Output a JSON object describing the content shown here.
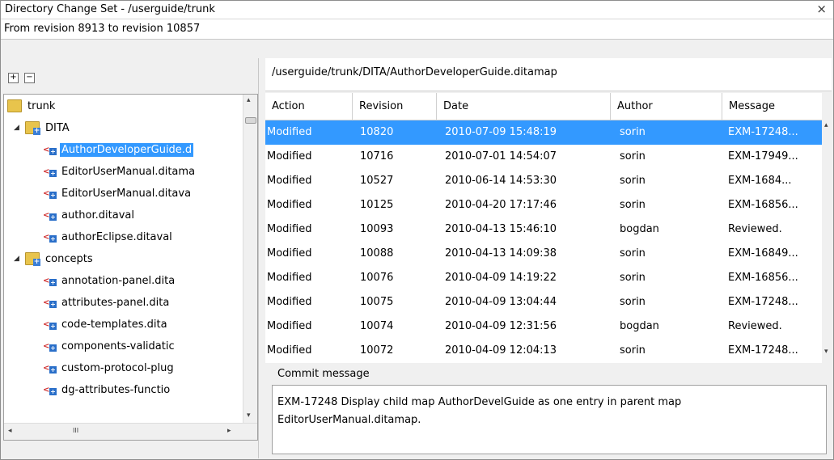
{
  "window": {
    "title": "Directory Change Set - /userguide/trunk",
    "close_glyph": "×",
    "revision_range": "From revision 8913 to revision 10857"
  },
  "toolbar": {
    "expand_icon": "expand-all-icon",
    "collapse_icon": "collapse-all-icon",
    "expand_glyph": "+",
    "collapse_glyph": "−"
  },
  "tree": {
    "nodes": [
      {
        "label": "trunk",
        "icon": "folder-icon"
      },
      {
        "label": "DITA",
        "icon": "folder-modified-icon"
      },
      {
        "label": "AuthorDeveloperGuide.d",
        "icon": "ditamap-icon"
      },
      {
        "label": "EditorUserManual.ditama",
        "icon": "ditamap-icon"
      },
      {
        "label": "EditorUserManual.ditava",
        "icon": "ditaval-icon"
      },
      {
        "label": "author.ditaval",
        "icon": "ditaval-icon"
      },
      {
        "label": "authorEclipse.ditaval",
        "icon": "ditaval-icon"
      },
      {
        "label": "concepts",
        "icon": "folder-modified-icon"
      },
      {
        "label": "annotation-panel.dita",
        "icon": "dita-icon"
      },
      {
        "label": "attributes-panel.dita",
        "icon": "dita-icon"
      },
      {
        "label": "code-templates.dita",
        "icon": "dita-icon"
      },
      {
        "label": "components-validatic",
        "icon": "dita-icon"
      },
      {
        "label": "custom-protocol-plug",
        "icon": "dita-icon"
      },
      {
        "label": "dg-attributes-functio",
        "icon": "dita-icon"
      }
    ],
    "scroll_left": "◂",
    "scroll_right": "▸",
    "scroll_up": "▴",
    "scroll_down": "▾",
    "hscroll_grip": "III"
  },
  "path": "/userguide/trunk/DITA/AuthorDeveloperGuide.ditamap",
  "table": {
    "columns": [
      "Action",
      "Revision",
      "Date",
      "Author",
      "Message"
    ],
    "rows": [
      [
        "Modified",
        "10820",
        "2010-07-09 15:48:19",
        "sorin",
        "EXM-17248..."
      ],
      [
        "Modified",
        "10716",
        "2010-07-01 14:54:07",
        "sorin",
        "EXM-17949..."
      ],
      [
        "Modified",
        "10527",
        "2010-06-14 14:53:30",
        "sorin",
        " EXM-1684..."
      ],
      [
        "Modified",
        "10125",
        "2010-04-20 17:17:46",
        "sorin",
        "EXM-16856..."
      ],
      [
        "Modified",
        "10093",
        "2010-04-13 15:46:10",
        "bogdan",
        "Reviewed."
      ],
      [
        "Modified",
        "10088",
        "2010-04-13 14:09:38",
        "sorin",
        "EXM-16849..."
      ],
      [
        "Modified",
        "10076",
        "2010-04-09 14:19:22",
        "sorin",
        "EXM-16856..."
      ],
      [
        "Modified",
        "10075",
        "2010-04-09 13:04:44",
        "sorin",
        "EXM-17248..."
      ],
      [
        "Modified",
        "10074",
        "2010-04-09 12:31:56",
        "bogdan",
        "Reviewed."
      ],
      [
        "Modified",
        "10072",
        "2010-04-09 12:04:13",
        "sorin",
        "EXM-17248..."
      ]
    ],
    "selected_row": 0
  },
  "commit": {
    "label": "Commit message",
    "text": "EXM-17248 Display child map AuthorDevelGuide as one entry in parent map\nEditorUserManual.ditamap."
  },
  "colors": {
    "selection": "#3399ff",
    "folder": "#e8c44c",
    "badge": "#2a6fc9"
  }
}
